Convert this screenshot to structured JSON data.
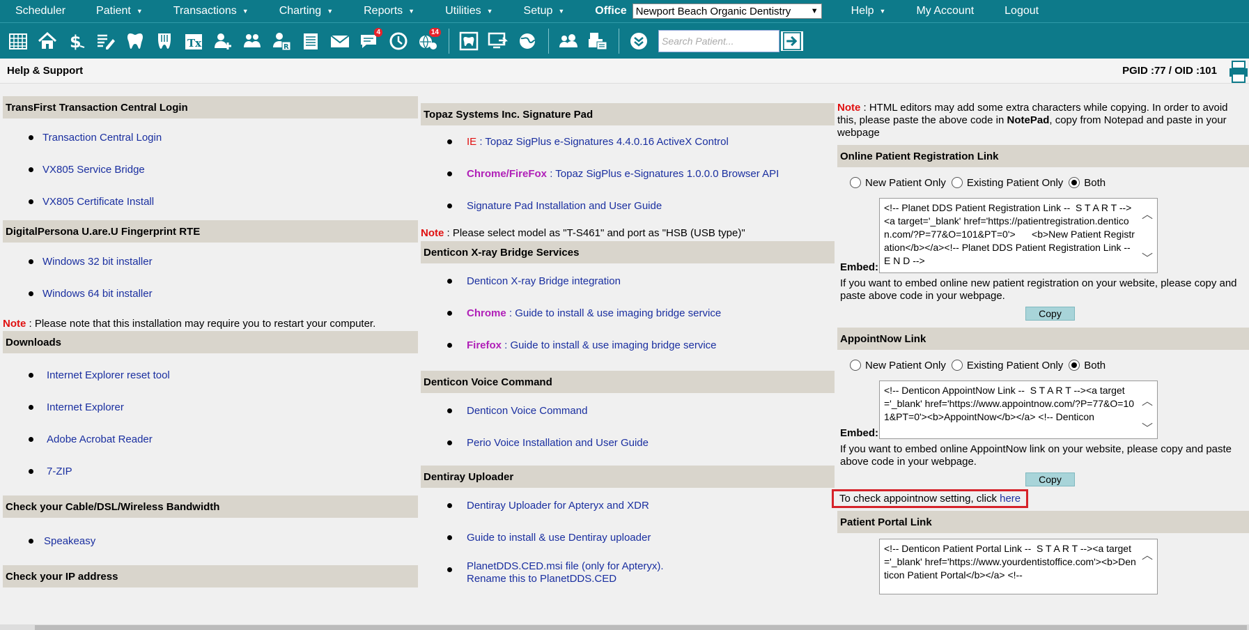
{
  "menu": {
    "items": [
      {
        "label": "Scheduler",
        "caret": false
      },
      {
        "label": "Patient",
        "caret": true
      },
      {
        "label": "Transactions",
        "caret": true
      },
      {
        "label": "Charting",
        "caret": true
      },
      {
        "label": "Reports",
        "caret": true
      },
      {
        "label": "Utilities",
        "caret": true
      },
      {
        "label": "Setup",
        "caret": true
      }
    ],
    "office_label": "Office",
    "office_value": "Newport Beach Organic Dentistry",
    "right_items": [
      {
        "label": "Help",
        "caret": true
      },
      {
        "label": "My Account",
        "caret": false
      },
      {
        "label": "Logout",
        "caret": false
      }
    ]
  },
  "toolbar": {
    "messages_badge": "4",
    "alerts_badge": "14",
    "search_placeholder": "Search Patient..."
  },
  "header": {
    "title": "Help & Support",
    "ids": "PGID :77  /  OID :101"
  },
  "left": {
    "transfirst": {
      "title": "TransFirst Transaction Central Login",
      "links": [
        "Transaction Central Login",
        "VX805 Service Bridge",
        "VX805 Certificate Install"
      ]
    },
    "digitalpersona": {
      "title": "DigitalPersona U.are.U Fingerprint RTE",
      "links": [
        "Windows 32 bit installer",
        "Windows 64 bit installer"
      ]
    },
    "note_label": "Note",
    "note_text": " : Please note that this installation may require you to restart your computer.",
    "downloads": {
      "title": "Downloads",
      "links": [
        "Internet Explorer reset tool",
        "Internet Explorer",
        "Adobe Acrobat Reader",
        "7-ZIP"
      ]
    },
    "bandwidth": {
      "title": "Check your Cable/DSL/Wireless Bandwidth",
      "links": [
        "Speakeasy"
      ]
    },
    "ip": {
      "title": "Check your IP address"
    }
  },
  "mid": {
    "topaz": {
      "title": "Topaz Systems Inc. Signature Pad",
      "ie_prefix": "IE",
      "ie_text": " : Topaz SigPlus e-Signatures 4.4.0.16 ActiveX Control",
      "chrome_prefix": "Chrome/FireFox",
      "chrome_text": " : Topaz SigPlus e-Signatures 1.0.0.0 Browser API",
      "guide": "Signature Pad Installation and User Guide",
      "note_label": "Note",
      "note_text": " : Please select model as \"T-S461\" and port as \"HSB (USB type)\""
    },
    "xray": {
      "title": "Denticon X-ray Bridge Services",
      "integration": "Denticon X-ray Bridge integration",
      "chrome_prefix": "Chrome",
      "chrome_text": " : Guide to install & use imaging bridge service",
      "firefox_prefix": "Firefox",
      "firefox_text": " : Guide to install & use imaging bridge service"
    },
    "voice": {
      "title": "Denticon Voice Command",
      "links": [
        "Denticon Voice Command",
        "Perio Voice Installation and User Guide"
      ]
    },
    "dentiray": {
      "title": "Dentiray Uploader",
      "links": [
        "Dentiray Uploader for Apteryx and XDR",
        "Guide to install & use Dentiray uploader"
      ],
      "ced_line1": "PlanetDDS.CED.msi file (only for Apteryx).",
      "ced_line2": "Rename this to PlanetDDS.CED"
    }
  },
  "right": {
    "note_label": "Note",
    "note_pre": " : HTML editors may add some extra characters while copying. In order to avoid this, please paste the above code in ",
    "note_bold": "NotePad",
    "note_post": ", copy from Notepad and paste in your webpage",
    "radio_new": "New Patient Only",
    "radio_existing": "Existing Patient Only",
    "radio_both": "Both",
    "embed_label": "Embed:",
    "copy_label": "Copy",
    "registration": {
      "title": "Online Patient Registration Link",
      "code": "<!-- Planet DDS Patient Registration Link --  S T A R T --><a target='_blank' href='https://patientregistration.denticon.com/?P=77&O=101&PT=0'>      <b>New Patient Registration</b></a><!-- Planet DDS Patient Registration Link --  E N D -->",
      "help": "If you want to embed online new patient registration on your website, please copy and paste above code in your webpage."
    },
    "appointnow": {
      "title": "AppointNow Link",
      "code": "<!-- Denticon AppointNow Link --  S T A R T --><a target='_blank' href='https://www.appointnow.com/?P=77&O=101&PT=0'><b>AppointNow</b></a> <!-- Denticon",
      "help": "If you want to embed online AppointNow link on your website, please copy and paste above code in your webpage.",
      "check_text": "To check appointnow setting, click ",
      "check_link": "here"
    },
    "portal": {
      "title": "Patient Portal Link",
      "code": "<!-- Denticon Patient Portal Link --  S T A R T --><a target='_blank' href='https://www.yourdentistoffice.com'><b>Denticon Patient Portal</b></a> <!--"
    }
  }
}
